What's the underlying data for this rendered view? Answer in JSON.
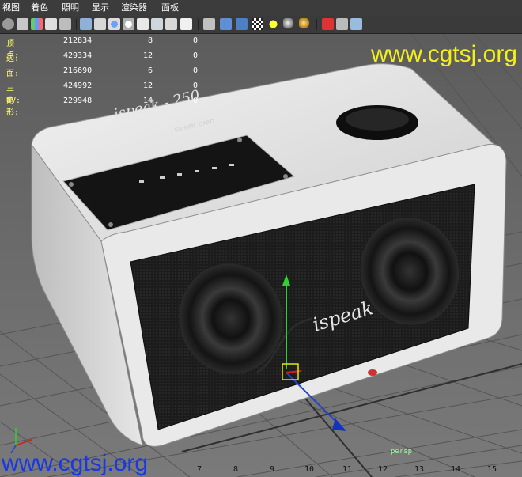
{
  "menu": {
    "items": [
      "视图",
      "着色",
      "照明",
      "显示",
      "渲染器",
      "面板"
    ]
  },
  "toolbar": {
    "icons": [
      "camera-icon",
      "bookmark-icon",
      "image-plane-icon",
      "grid-icon",
      "wireframe-icon",
      "smooth-shade-icon",
      "textured-icon",
      "lights-icon",
      "shadows-icon",
      "cube-icon",
      "cube-shaded-icon",
      "checker-icon",
      "sphere-light-icon",
      "sphere-grey-icon",
      "sphere-gold-icon",
      "isolate-icon",
      "xray-icon",
      "frame-icon"
    ]
  },
  "watermark": {
    "top": "www.cgtsj.org",
    "bottom": "www.cgtsj.org"
  },
  "hud": {
    "rows": [
      {
        "label": "顶点:",
        "v1": "212834",
        "v2": "8",
        "v3": "0"
      },
      {
        "label": "边:",
        "v1": "429334",
        "v2": "12",
        "v3": "0"
      },
      {
        "label": "面:",
        "v1": "216690",
        "v2": "6",
        "v3": "0"
      },
      {
        "label": "三角形:",
        "v1": "424992",
        "v2": "12",
        "v3": "0"
      },
      {
        "label": "UV:",
        "v1": "229948",
        "v2": "14",
        "v3": "0"
      }
    ]
  },
  "scene": {
    "speaker_brand": "ispeak",
    "panel_brand": "ispeak - 250",
    "panel_subtitle": "SD/MMC CARD",
    "camera": "persp"
  },
  "ruler": {
    "numbers": [
      "7",
      "8",
      "9",
      "10",
      "11",
      "12",
      "13",
      "14",
      "15"
    ]
  },
  "colors": {
    "watermark_top": "#f2ef1a",
    "watermark_bottom": "#1638e6",
    "speaker_body": "#e4e4e4",
    "speaker_grille": "#1a1a1a"
  }
}
